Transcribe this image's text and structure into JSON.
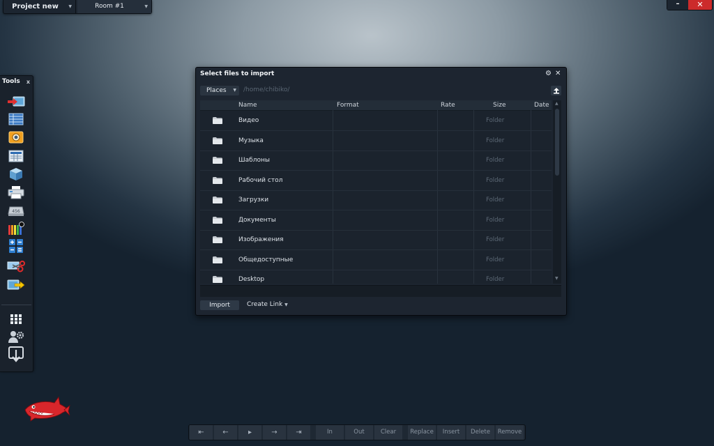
{
  "topbar": {
    "project_label": "Project new",
    "room_label": "Room #1"
  },
  "window_controls": {
    "minimize": "–",
    "close": "✕"
  },
  "tools": {
    "title": "Tools",
    "pin_glyph": "x",
    "items": [
      {
        "name": "import-tool",
        "icon": "arrow-into-screen-icon"
      },
      {
        "name": "list-tool",
        "icon": "list-icon"
      },
      {
        "name": "camera-tool",
        "icon": "camera-icon"
      },
      {
        "name": "table-tool",
        "icon": "grid-icon"
      },
      {
        "name": "cube-tool",
        "icon": "cube-icon"
      },
      {
        "name": "printer-tool",
        "icon": "printer-icon"
      },
      {
        "name": "scanner-tool",
        "icon": "scanner-icon"
      },
      {
        "name": "colors-tool",
        "icon": "color-pencils-icon"
      },
      {
        "name": "calculator-tool",
        "icon": "calculator-icon"
      },
      {
        "name": "cut-tool",
        "icon": "scissors-icon"
      },
      {
        "name": "export-tool",
        "icon": "arrow-out-icon"
      },
      {
        "name": "apps-tool",
        "icon": "apps-grid-icon"
      },
      {
        "name": "users-settings-tool",
        "icon": "users-gear-icon"
      },
      {
        "name": "download-tool",
        "icon": "download-icon"
      }
    ]
  },
  "dialog": {
    "title": "Select files to import",
    "places_label": "Places",
    "path": "/home/chibiko/",
    "columns": [
      "Name",
      "Format",
      "Rate",
      "Size",
      "Date"
    ],
    "rows": [
      {
        "name": "Видео",
        "size": "Folder"
      },
      {
        "name": "Музыка",
        "size": "Folder"
      },
      {
        "name": "Шаблоны",
        "size": "Folder"
      },
      {
        "name": "Рабочий стол",
        "size": "Folder"
      },
      {
        "name": "Загрузки",
        "size": "Folder"
      },
      {
        "name": "Документы",
        "size": "Folder"
      },
      {
        "name": "Изображения",
        "size": "Folder"
      },
      {
        "name": "Общедоступные",
        "size": "Folder"
      },
      {
        "name": "Desktop",
        "size": "Folder"
      }
    ],
    "import_label": "Import",
    "create_link_label": "Create Link"
  },
  "transport": {
    "nav": [
      "⇤",
      "←",
      "▸",
      "→",
      "⇥"
    ],
    "edit": [
      "In",
      "Out",
      "Clear",
      "Replace",
      "Insert",
      "Delete",
      "Remove"
    ]
  }
}
